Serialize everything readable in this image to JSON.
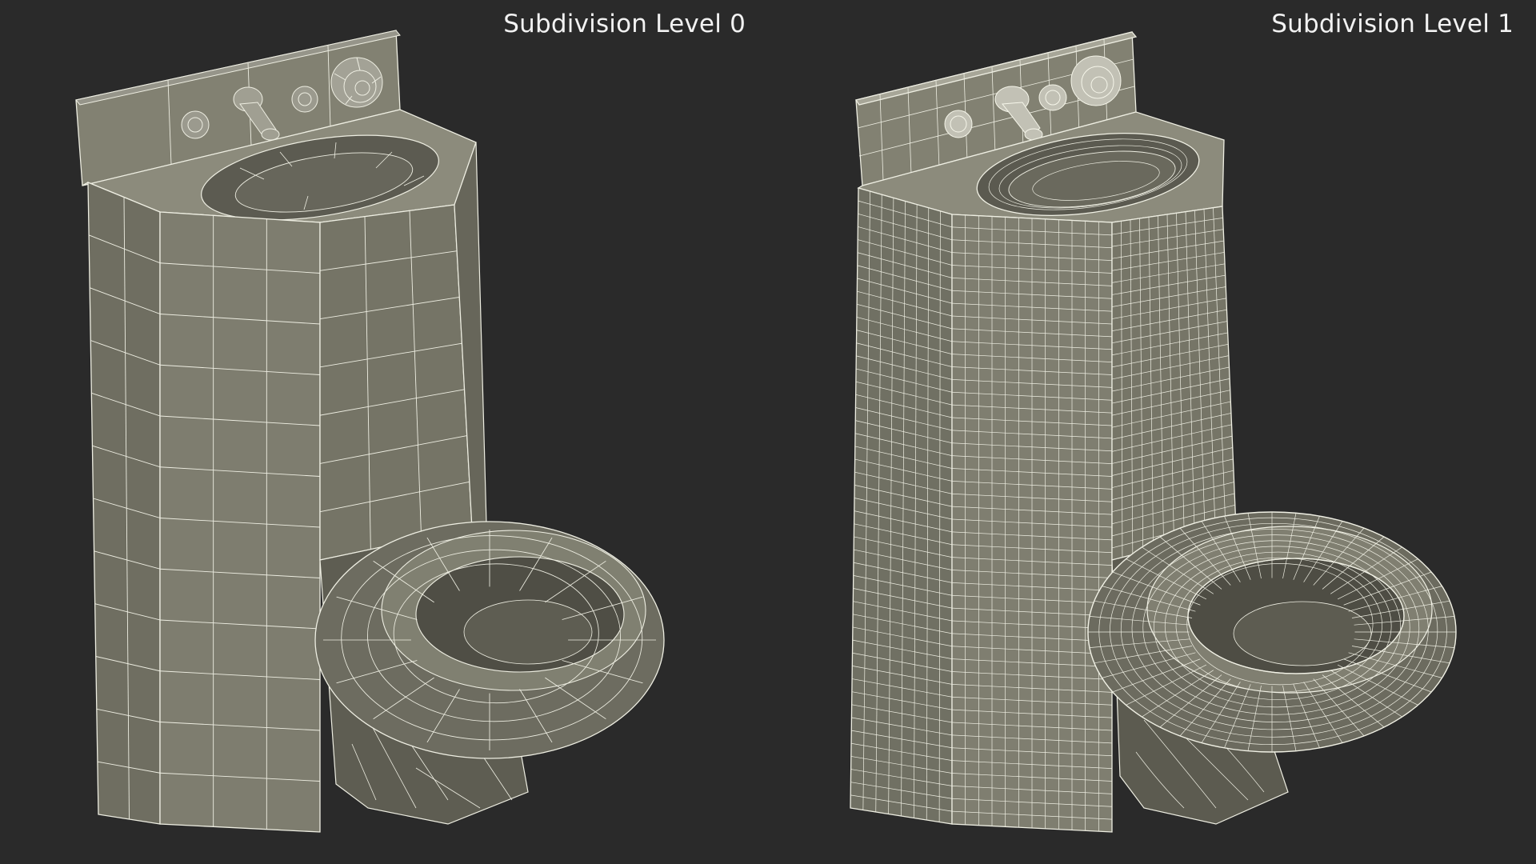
{
  "panels": [
    {
      "label": "Subdivision Level 0",
      "subdivision_level": 0,
      "object": "combination-sink-toilet-wireframe"
    },
    {
      "label": "Subdivision Level 1",
      "subdivision_level": 1,
      "object": "combination-sink-toilet-wireframe"
    }
  ],
  "colors": {
    "background": "#2a2a2a",
    "surface_front": "#7e7d6f",
    "surface_side": "#6e6d60",
    "surface_top": "#8c8b7c",
    "surface_dark": "#4e4d44",
    "wire": "#eeeee2"
  }
}
